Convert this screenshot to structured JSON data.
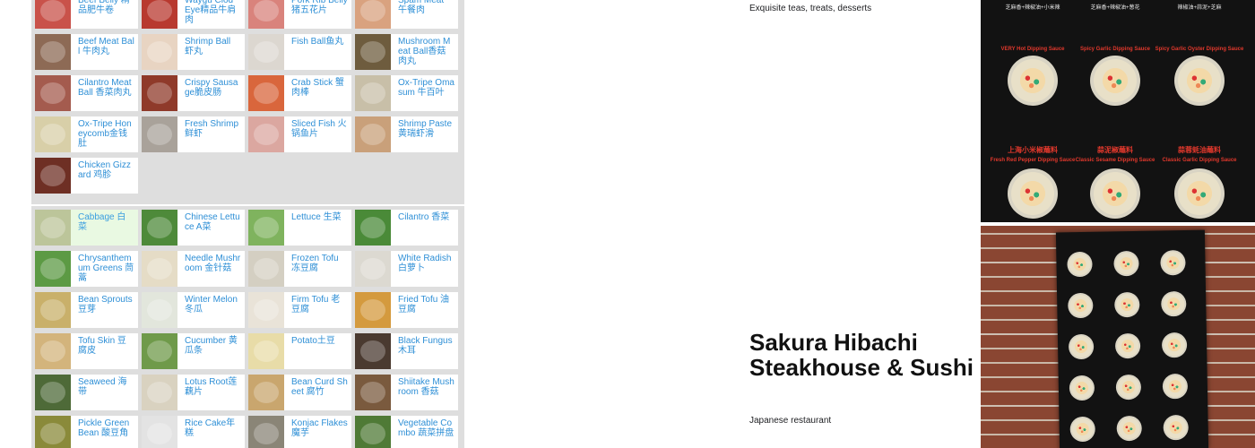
{
  "menu": {
    "top_items": [
      {
        "label": "Beef Belly 精品肥牛卷",
        "color": "#c9524a"
      },
      {
        "label": "Waygu Clod Eye精品牛肩肉",
        "color": "#b8392f"
      },
      {
        "label": "Pork Rib Belly 猪五花片",
        "color": "#d9837c"
      },
      {
        "label": "Spam Meat 午餐肉",
        "color": "#d9a27f"
      },
      {
        "label": "Beef Meat Ball 牛肉丸",
        "color": "#8d6a55"
      },
      {
        "label": "Shrimp Ball 虾丸",
        "color": "#e8d4c2"
      },
      {
        "label": "Fish Ball鱼丸",
        "color": "#dcd7d0"
      },
      {
        "label": "Mushroom Meat Ball香菇肉丸",
        "color": "#6e5c3e"
      },
      {
        "label": "Cilantro Meat Ball 香菜肉丸",
        "color": "#a45b4e"
      },
      {
        "label": "Crispy Sausage脆皮肠",
        "color": "#8f3a2a"
      },
      {
        "label": "Crab Stick 蟹肉棒",
        "color": "#d9663c"
      },
      {
        "label": "Ox-Tripe Omasum 牛百叶",
        "color": "#c8bfa8"
      },
      {
        "label": "Ox-Tripe Honeycomb金钱肚",
        "color": "#d8cfa8"
      },
      {
        "label": "Fresh Shrimp 鲜虾",
        "color": "#a9a29a"
      },
      {
        "label": "Sliced Fish 火锅鱼片",
        "color": "#dba7a0"
      },
      {
        "label": "Shrimp Paste 黄瑞虾滑",
        "color": "#c9a07a"
      },
      {
        "label": "Chicken Gizzard 鸡胗",
        "color": "#6e2f24"
      }
    ],
    "bottom_items": [
      {
        "label": "Cabbage 白菜",
        "color": "#bcc59a",
        "selected": true
      },
      {
        "label": "Chinese Lettuce A菜",
        "color": "#4e8a3a"
      },
      {
        "label": "Lettuce 生菜",
        "color": "#7fb35e"
      },
      {
        "label": "Cilantro 香菜",
        "color": "#4a8a38"
      },
      {
        "label": "Chrysanthemum Greens 茼蒿",
        "color": "#5c9a44"
      },
      {
        "label": "Needle Mushroom 金针菇",
        "color": "#e5dcc6"
      },
      {
        "label": "Frozen Tofu 冻豆腐",
        "color": "#d4cfc2"
      },
      {
        "label": "White Radish 白萝卜",
        "color": "#dcd9d1"
      },
      {
        "label": "Bean Sprouts 豆芽",
        "color": "#c9b06a"
      },
      {
        "label": "Winter Melon 冬瓜",
        "color": "#e2e6dc"
      },
      {
        "label": "Firm Tofu 老豆腐",
        "color": "#e9e3d8"
      },
      {
        "label": "Fried Tofu 油豆腐",
        "color": "#d49a3e"
      },
      {
        "label": "Tofu Skin 豆腐皮",
        "color": "#d3b47c"
      },
      {
        "label": "Cucumber 黄瓜条",
        "color": "#6f9a4a"
      },
      {
        "label": "Potato土豆",
        "color": "#e8dca8"
      },
      {
        "label": "Black Fungus 木耳",
        "color": "#4a3a30"
      },
      {
        "label": "Seaweed 海带",
        "color": "#4e6a38"
      },
      {
        "label": "Lotus Root莲藕片",
        "color": "#d9d2c0"
      },
      {
        "label": "Bean Curd Sheet 腐竹",
        "color": "#c9a66e"
      },
      {
        "label": "Shiitake Mushroom 香菇",
        "color": "#7a5a3e"
      },
      {
        "label": "Pickle Green Bean 酸豆角",
        "color": "#8a8a3a"
      },
      {
        "label": "Rice Cake年糕",
        "color": "#e3e3e3"
      },
      {
        "label": "Konjac Flakes 魔芋",
        "color": "#8a8577"
      },
      {
        "label": "Vegetable Combo 蔬菜拼盘",
        "color": "#4f7a36"
      }
    ]
  },
  "place": {
    "top_subtitle": "Exquisite teas, treats, desserts",
    "title": "Sakura Hibachi Steakhouse & Sushi",
    "type": "Japanese restaurant"
  },
  "photos": {
    "poster_headings": [
      "芝麻香+辣椒油+小米辣",
      "芝麻香+辣椒油+葱花",
      "辣椒油+蒜泥+芝麻"
    ],
    "poster_sauces": [
      "VERY Hot Dipping Sauce",
      "Spicy Garlic Dipping Sauce",
      "Spicy Garlic Oyster Dipping Sauce"
    ],
    "poster_red_titles": [
      "上海小米椒蘸料",
      "蒜泥椒蘸料",
      "蒜蓉蚝油蘸料"
    ],
    "poster_bottom_titles": [
      "Fresh Red Pepper Dipping Sauce",
      "Classic Sesame Dipping Sauce",
      "Classic Garlic Dipping Sauce"
    ]
  }
}
